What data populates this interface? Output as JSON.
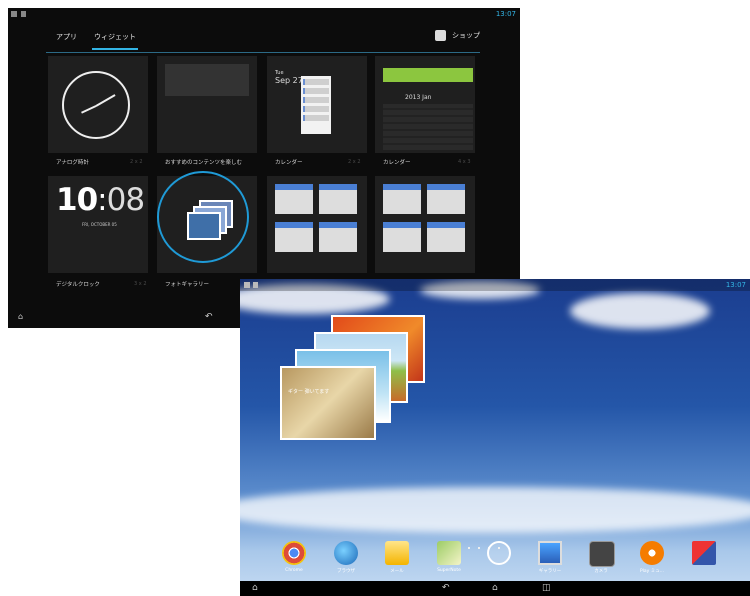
{
  "picker": {
    "status_time": "13:07",
    "tabs": [
      "アプリ",
      "ウィジェット"
    ],
    "shop_label": "ショップ",
    "widgets": [
      {
        "name": "アナログ時計",
        "size": "2 x 2"
      },
      {
        "name": "おすすめのコンテンツを楽しむ",
        "size": "2 x 2"
      },
      {
        "name": "カレンダー",
        "size": "2 x 2"
      },
      {
        "name": "カレンダー",
        "size": "4 x 3"
      },
      {
        "name": "デジタルクロック",
        "size": "3 x 2"
      },
      {
        "name": "フォトギャラリー",
        "size": ""
      },
      {
        "name": "",
        "size": ""
      },
      {
        "name": "",
        "size": ""
      }
    ],
    "calendar_small": {
      "day": "Tue",
      "date": "Sep 27"
    },
    "calendar_large": {
      "month": "2013 Jan"
    },
    "digital_clock": {
      "hours": "10",
      "minutes": "08",
      "date": "FRI, OCTOBER 05"
    }
  },
  "home": {
    "status_time": "13:07",
    "photo_caption": "ギター 弾いてます",
    "dock": [
      {
        "icon": "chrome-icon",
        "label": "Chrome"
      },
      {
        "icon": "globe-icon",
        "label": "ブラウザ"
      },
      {
        "icon": "email-icon",
        "label": "メール"
      },
      {
        "icon": "notes-icon",
        "label": "SuperNote"
      },
      {
        "icon": "app-drawer-icon",
        "label": ""
      },
      {
        "icon": "gallery-icon",
        "label": "ギャラリー"
      },
      {
        "icon": "camera-icon",
        "label": "カメラ"
      },
      {
        "icon": "music-icon",
        "label": "Play ミュ..."
      },
      {
        "icon": "asus-icon",
        "label": ""
      }
    ]
  }
}
